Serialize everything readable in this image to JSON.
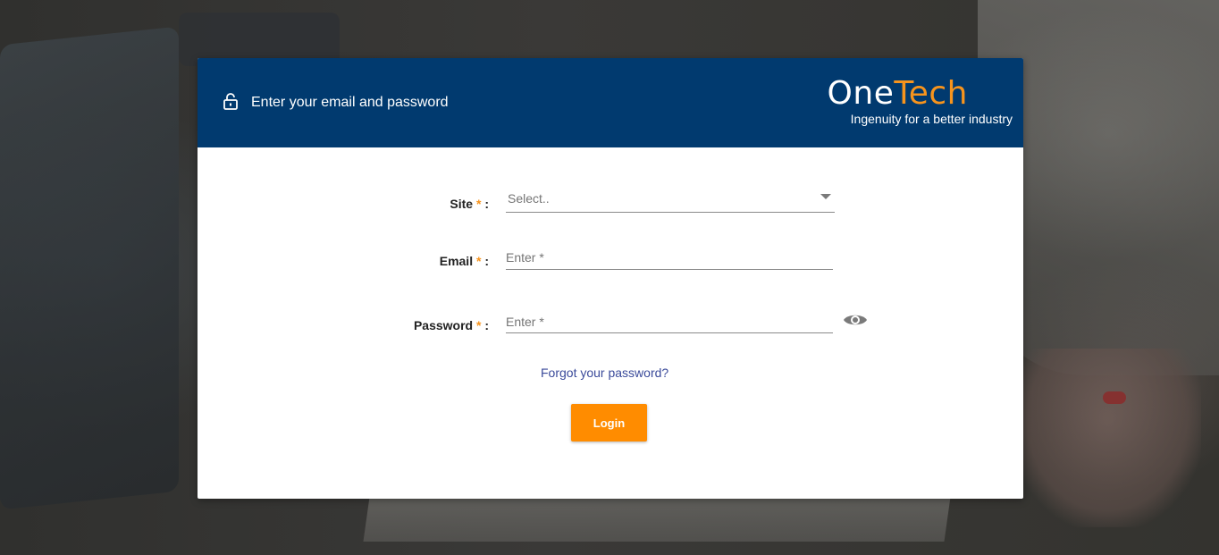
{
  "header": {
    "title": "Enter your email and password",
    "lock_icon": "lock-open-icon"
  },
  "logo": {
    "word_one": "One",
    "word_tech": "Tech",
    "tagline": "Ingenuity for a better industry"
  },
  "form": {
    "site": {
      "label": "Site",
      "required_marker": "*",
      "colon": ":",
      "value": "Select.."
    },
    "email": {
      "label": "Email",
      "required_marker": "*",
      "colon": ":",
      "placeholder": "Enter *"
    },
    "password": {
      "label": "Password",
      "required_marker": "*",
      "colon": ":",
      "placeholder": "Enter *",
      "toggle_icon": "eye-icon"
    },
    "forgot_link": "Forgot your password?",
    "login_button": "Login"
  },
  "colors": {
    "header_bg": "#013a6f",
    "accent": "#ff8c00",
    "link": "#3a4a9a"
  }
}
